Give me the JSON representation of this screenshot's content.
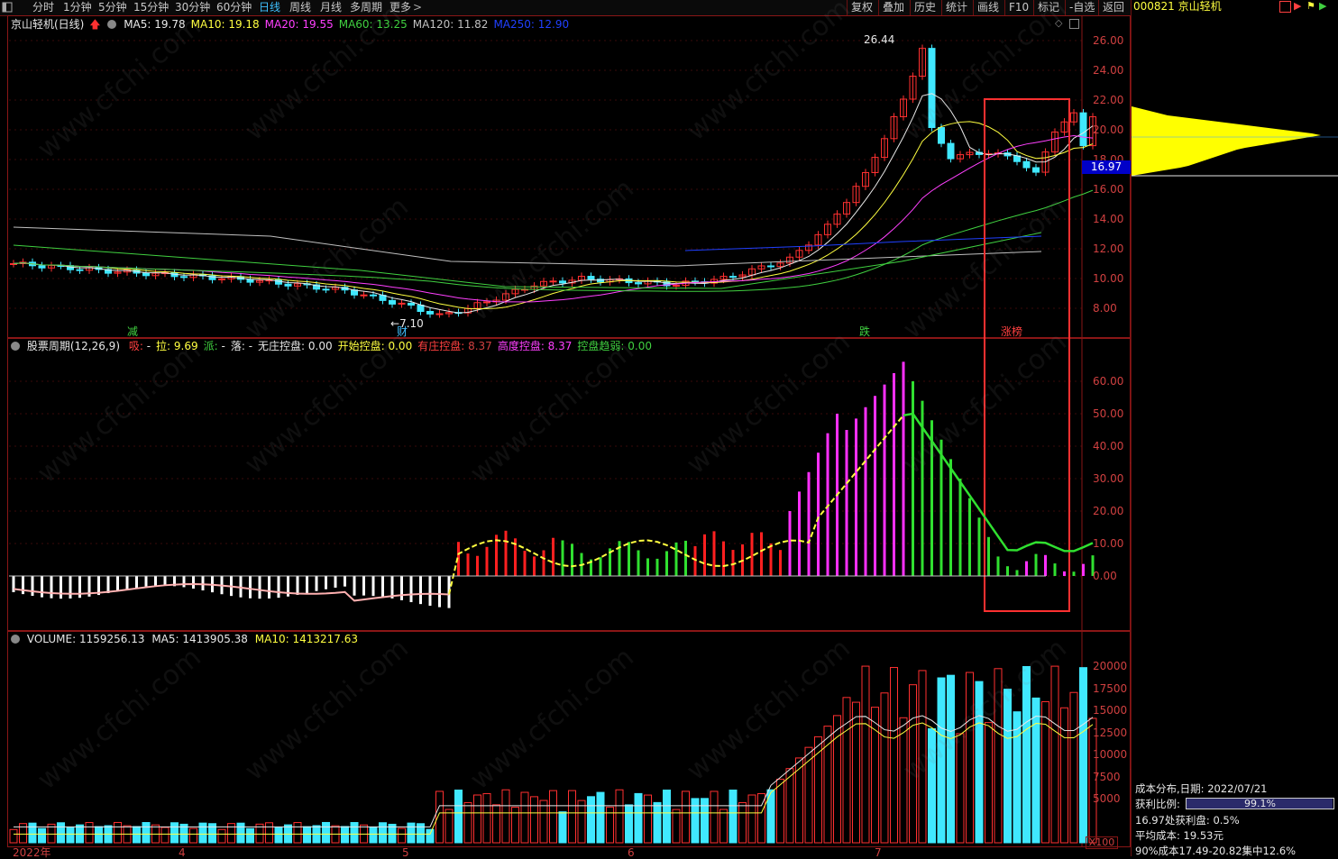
{
  "toolbar": {
    "periods": [
      "分时",
      "1分钟",
      "5分钟",
      "15分钟",
      "30分钟",
      "60分钟",
      "日线",
      "周线",
      "月线",
      "多周期",
      "更多"
    ],
    "active_period": "日线",
    "right_buttons": [
      "复权",
      "叠加",
      "历史",
      "统计",
      "画线",
      "F10",
      "标记",
      "-自选",
      "返回"
    ]
  },
  "sidebar": {
    "stock_code": "000821",
    "stock_name": "京山轻机",
    "price_marker": "16.97",
    "cost_title": "成本分布,日期:",
    "cost_date": "2022/07/21",
    "profit_ratio_label": "获利比例:",
    "profit_ratio_value": "99.1%",
    "profit_ratio_fraction": 0.991,
    "profit_at_price": "16.97处获利盘: 0.5%",
    "avg_cost": "平均成本: 19.53元",
    "cost90": "90%成本17.49-20.82集中12.6%"
  },
  "main_chart": {
    "title": "京山轻机(日线)",
    "ma": [
      {
        "label": "MA5:",
        "value": "19.78",
        "color": "#e8e8e8"
      },
      {
        "label": "MA10:",
        "value": "19.18",
        "color": "#ffff40"
      },
      {
        "label": "MA20:",
        "value": "19.55",
        "color": "#ff40ff"
      },
      {
        "label": "MA60:",
        "value": "13.25",
        "color": "#40d040"
      },
      {
        "label": "MA120:",
        "value": "11.82",
        "color": "#c0c0c0"
      },
      {
        "label": "MA250:",
        "value": "12.90",
        "color": "#2040ff"
      }
    ],
    "high_label": "26.44",
    "low_label": "7.10",
    "y_ticks": [
      "26.00",
      "24.00",
      "22.00",
      "20.00",
      "18.00",
      "16.00",
      "14.00",
      "12.00",
      "10.00",
      "8.00"
    ],
    "bottom_marks": [
      {
        "text": "减",
        "color": "#40d040"
      },
      {
        "text": "财",
        "color": "#40c0ff"
      },
      {
        "text": "跌",
        "color": "#40d040"
      },
      {
        "text": "涨榜",
        "color": "#ff4040"
      }
    ]
  },
  "indicator": {
    "name": "股票周期(12,26,9)",
    "fields": [
      {
        "label": "吸:",
        "value": "-",
        "color": "#ff4040"
      },
      {
        "label": "拉:",
        "value": "9.69",
        "color": "#ffff40"
      },
      {
        "label": "派:",
        "value": "-",
        "color": "#40d040"
      },
      {
        "label": "落:",
        "value": "-",
        "color": "#e8e8e8"
      },
      {
        "label": "无庄控盘:",
        "value": "0.00",
        "color": "#e8e8e8"
      },
      {
        "label": "开始控盘:",
        "value": "0.00",
        "color": "#ffff40"
      },
      {
        "label": "有庄控盘:",
        "value": "8.37",
        "color": "#ff4040"
      },
      {
        "label": "高度控盘:",
        "value": "8.37",
        "color": "#ff40ff"
      },
      {
        "label": "控盘趋弱:",
        "value": "0.00",
        "color": "#40d040"
      }
    ],
    "y_ticks": [
      "60.00",
      "50.00",
      "40.00",
      "30.00",
      "20.00",
      "10.00",
      "0.00"
    ]
  },
  "volume": {
    "label": "VOLUME:",
    "value": "1159256.13",
    "ma5_label": "MA5:",
    "ma5": "1413905.38",
    "ma10_label": "MA10:",
    "ma10": "1413217.63",
    "y_ticks": [
      "20000",
      "17500",
      "15000",
      "12500",
      "10000",
      "7500",
      "5000"
    ],
    "unit": "X100"
  },
  "x_axis": [
    "2022年",
    "4",
    "5",
    "6",
    "7"
  ],
  "watermark": "www.cfchi.com"
}
